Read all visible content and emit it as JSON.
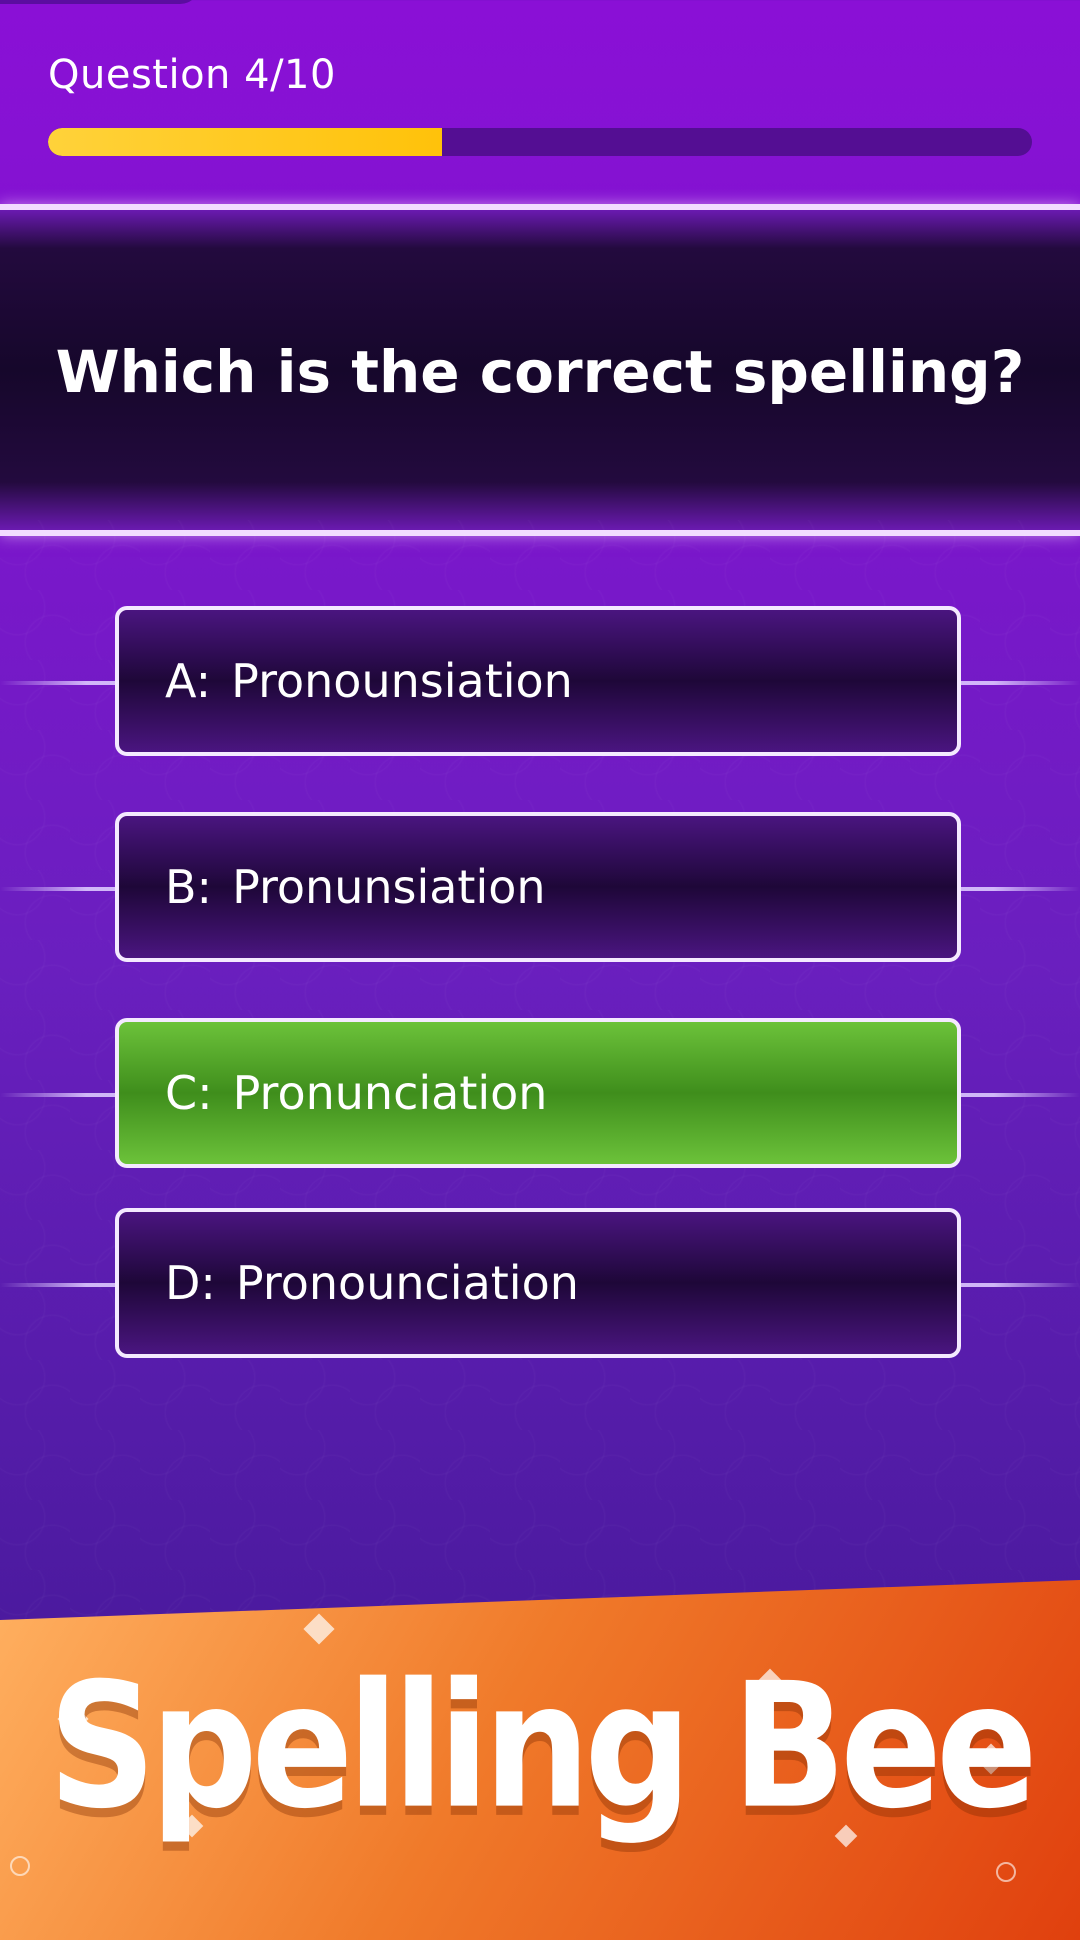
{
  "header": {
    "question_counter": "Question 4/10",
    "progress_fraction": 0.4
  },
  "question": {
    "text": "Which is the correct spelling?"
  },
  "answers": [
    {
      "letter": "A:",
      "text": "Pronounsiation",
      "state": "neutral"
    },
    {
      "letter": "B:",
      "text": "Pronunsiation",
      "state": "neutral"
    },
    {
      "letter": "C:",
      "text": "Pronunciation",
      "state": "correct"
    },
    {
      "letter": "D:",
      "text": "Pronounciation",
      "state": "neutral"
    }
  ],
  "banner": {
    "title": "Spelling Bee"
  },
  "colors": {
    "background": "#7c16cc",
    "progress": "#ffc20a",
    "correct": "#4fa82a",
    "banner": "#f07a2a"
  }
}
